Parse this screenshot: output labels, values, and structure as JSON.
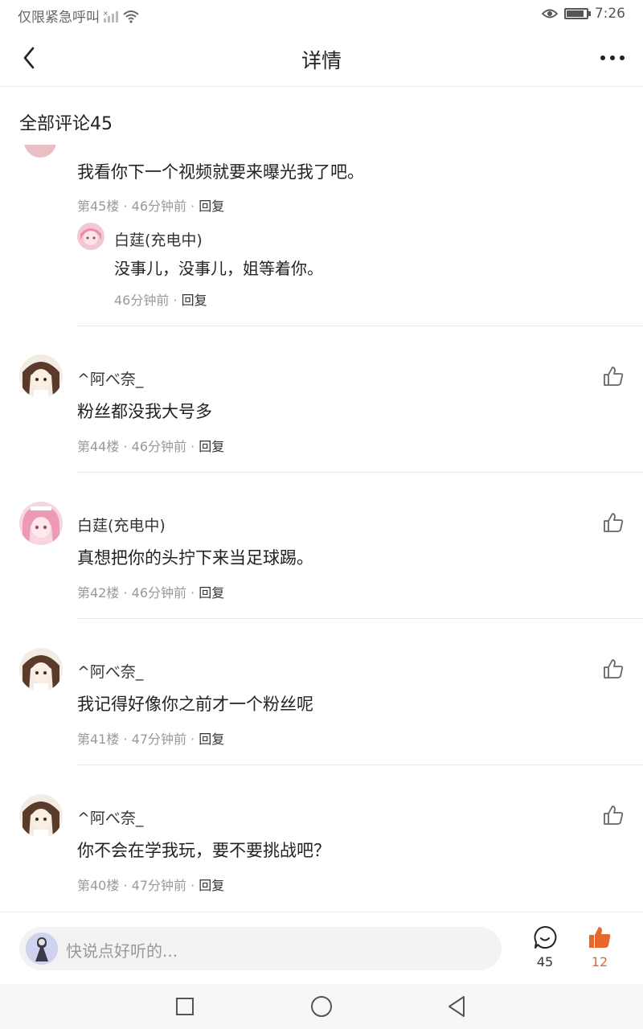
{
  "status_bar": {
    "carrier": "仅限紧急呼叫",
    "time": "7:26"
  },
  "nav": {
    "title": "详情"
  },
  "section": {
    "title": "全部评论45"
  },
  "comments": [
    {
      "text": "我看你下一个视频就要来曝光我了吧。",
      "floor": "第45楼",
      "time": "46分钟前",
      "reply_label": "回复",
      "sub_reply": {
        "user": "白莛(充电中)",
        "text": "没事儿，没事儿，姐等着你。",
        "time": "46分钟前",
        "reply_label": "回复"
      }
    },
    {
      "user": "^阿べ奈_",
      "text": "粉丝都没我大号多",
      "floor": "第44楼",
      "time": "46分钟前",
      "reply_label": "回复"
    },
    {
      "user": "白莛(充电中)",
      "text": "真想把你的头拧下来当足球踢。",
      "floor": "第42楼",
      "time": "46分钟前",
      "reply_label": "回复"
    },
    {
      "user": "^阿べ奈_",
      "text": "我记得好像你之前才一个粉丝呢",
      "floor": "第41楼",
      "time": "47分钟前",
      "reply_label": "回复"
    },
    {
      "user": "^阿べ奈_",
      "text": "你不会在学我玩，要不要挑战吧？",
      "floor": "第40楼",
      "time": "47分钟前",
      "reply_label": "回复"
    }
  ],
  "bottom_bar": {
    "placeholder": "快说点好听的...",
    "comment_count": "45",
    "like_count": "12"
  },
  "colors": {
    "accent": "#e8672a",
    "meta_gray": "#999999",
    "divider": "#e8e8e8"
  },
  "icons": [
    "back-icon",
    "more-icon",
    "like-icon",
    "comment-icon",
    "thumb-filled-icon",
    "eye-icon",
    "wifi-icon",
    "battery-icon",
    "square-icon",
    "circle-icon",
    "triangle-back-icon"
  ]
}
